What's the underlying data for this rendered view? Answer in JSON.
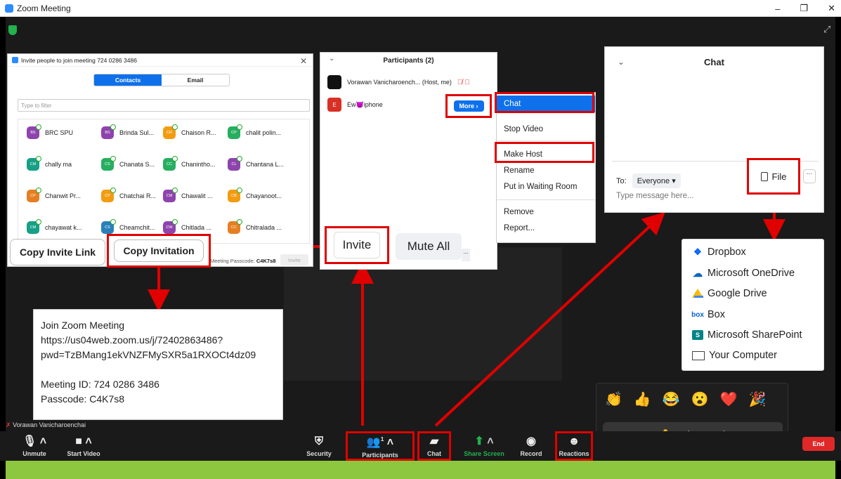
{
  "window": {
    "title": "Zoom Meeting",
    "controls": [
      "–",
      "❐",
      "✕"
    ]
  },
  "invite_dialog": {
    "title": "Invite people to join meeting 724 0286 3486",
    "tabs": [
      "Contacts",
      "Email"
    ],
    "filter_placeholder": "Type to filter",
    "contacts": [
      {
        "initials": "BS",
        "name": "BRC SPU",
        "color": "#8e44ad"
      },
      {
        "initials": "BS",
        "name": "Brinda Sul...",
        "color": "#8e44ad"
      },
      {
        "initials": "CR",
        "name": "Chaison R...",
        "color": "#f39c12"
      },
      {
        "initials": "CP",
        "name": "chalit polin...",
        "color": "#27ae60"
      },
      {
        "initials": "CM",
        "name": "chally ma",
        "color": "#16a085"
      },
      {
        "initials": "CS",
        "name": "Chanata S...",
        "color": "#27ae60"
      },
      {
        "initials": "CC",
        "name": "Chanintho...",
        "color": "#27ae60"
      },
      {
        "initials": "CL",
        "name": "Chantana L...",
        "color": "#8e44ad"
      },
      {
        "initials": "CP",
        "name": "Chanwit Pr...",
        "color": "#e67e22"
      },
      {
        "initials": "CP",
        "name": "Chatchai R...",
        "color": "#f39c12"
      },
      {
        "initials": "CM",
        "name": "Chawalit ...",
        "color": "#8e44ad"
      },
      {
        "initials": "CB",
        "name": "Chayanoot...",
        "color": "#f39c12"
      },
      {
        "initials": "CM",
        "name": "chayawat k...",
        "color": "#16a085"
      },
      {
        "initials": "CS",
        "name": "Cheamchit...",
        "color": "#2980b9"
      },
      {
        "initials": "CW",
        "name": "Chitlada ...",
        "color": "#8e44ad"
      },
      {
        "initials": "CC",
        "name": "Chitralada ...",
        "color": "#e67e22"
      }
    ],
    "passcode_label": "Meeting Passcode:",
    "passcode_value": "C4K7s8",
    "invite_button": "Invite",
    "copy_invite_link": "Copy Invite Link",
    "copy_invitation": "Copy Invitation"
  },
  "participants": {
    "title": "Participants (2)",
    "rows": [
      {
        "initial": "",
        "name": "Vorawan Vanicharoench... (Host, me)",
        "color": "#111111"
      },
      {
        "initial": "E",
        "name": "Ew😈iphone",
        "color": "#d93025"
      }
    ],
    "more_button": "More ›",
    "invite_button": "Invite",
    "mute_all_button": "Mute All",
    "more_dots": "..."
  },
  "context_menu": {
    "items": [
      "Chat",
      "Stop Video",
      "Make Host",
      "Rename",
      "Put in Waiting Room",
      "Remove",
      "Report..."
    ]
  },
  "chat": {
    "title": "Chat",
    "to_label": "To:",
    "to_value": "Everyone ▾",
    "placeholder": "Type message here...",
    "file_button": "File",
    "more": "···"
  },
  "share_menu": {
    "items": [
      {
        "label": "Dropbox",
        "icon": "dropbox-icon"
      },
      {
        "label": "Microsoft OneDrive",
        "icon": "onedrive-icon"
      },
      {
        "label": "Google Drive",
        "icon": "google-drive-icon"
      },
      {
        "label": "Box",
        "icon": "box-icon"
      },
      {
        "label": "Microsoft SharePoint",
        "icon": "sharepoint-icon"
      },
      {
        "label": "Your Computer",
        "icon": "computer-icon"
      }
    ]
  },
  "invitation_text": {
    "line1": "Join Zoom Meeting",
    "line2": "https://us04web.zoom.us/j/72402863486?",
    "line3": "pwd=TzBMang1ekVNZFMySXR5a1RXOCt4dz09",
    "line4": "Meeting ID: 724 0286 3486",
    "line5": "Passcode: C4K7s8"
  },
  "reactions": {
    "emojis": [
      "👏",
      "👍",
      "😂",
      "😮",
      "❤️",
      "🎉"
    ],
    "raise_hand": "Raise Hand"
  },
  "self_name": "Vorawan Vanicharoenchai",
  "toolbar": {
    "unmute": "Unmute",
    "start_video": "Start Video",
    "security": "Security",
    "participants": "Participants",
    "participants_count": "1",
    "chat": "Chat",
    "share_screen": "Share Screen",
    "record": "Record",
    "reactions": "Reactions",
    "end": "End"
  },
  "colors": {
    "zoom_blue": "#0e71eb",
    "highlight_red": "#e00000",
    "share_green": "#22b14c",
    "end_red": "#e02828"
  }
}
